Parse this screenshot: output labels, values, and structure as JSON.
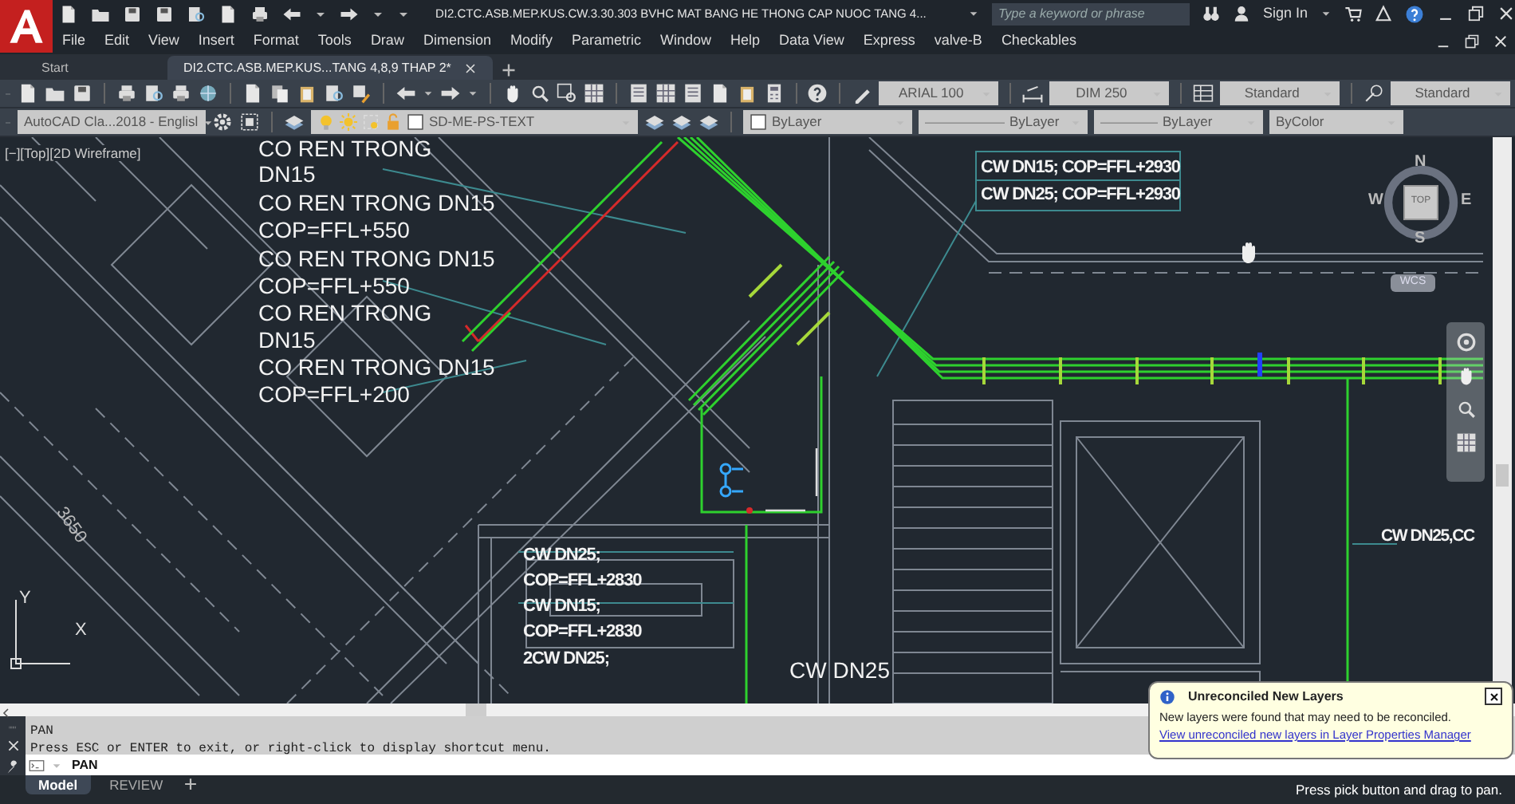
{
  "app_title": "DI2.CTC.ASB.MEP.KUS.CW.3.30.303 BVHC MAT BANG HE THONG CAP NUOC TANG 4...",
  "search": {
    "placeholder": "Type a keyword or phrase"
  },
  "sign_in": "Sign In",
  "menu": [
    "File",
    "Edit",
    "View",
    "Insert",
    "Format",
    "Tools",
    "Draw",
    "Dimension",
    "Modify",
    "Parametric",
    "Window",
    "Help",
    "Data View",
    "Express",
    "valve-B",
    "Checkables"
  ],
  "doc_tabs": [
    {
      "label": "Start",
      "selected": false
    },
    {
      "label": "DI2.CTC.ASB.MEP.KUS...TANG 4,8,9 THAP 2*",
      "selected": true
    }
  ],
  "style_dropdowns": [
    {
      "kind": "text",
      "value": "ARIAL 100"
    },
    {
      "kind": "dimension",
      "value": "DIM 250"
    },
    {
      "kind": "table",
      "value": "Standard"
    },
    {
      "kind": "multileader",
      "value": "Standard"
    }
  ],
  "workspace": "AutoCAD Cla...2018 - Englisl",
  "layer": "SD-ME-PS-TEXT",
  "property_dropdowns": [
    {
      "kind": "color",
      "value": "ByLayer"
    },
    {
      "kind": "linetype",
      "value": "ByLayer"
    },
    {
      "kind": "lineweight",
      "value": "ByLayer"
    },
    {
      "kind": "plotstyle",
      "value": "ByColor"
    }
  ],
  "viewport_label": "[−][Top][2D Wireframe]",
  "annotations": [
    "CO REN TRONG",
    "DN15",
    "CO REN TRONG DN15",
    "COP=FFL+550",
    "CO REN TRONG DN15",
    "COP=FFL+550",
    "CO REN TRONG",
    "DN15",
    "CO REN TRONG DN15",
    "COP=FFL+200",
    "CW DN15; COP=FFL+2930",
    "CW DN25; COP=FFL+2930",
    "CW DN25;",
    "COP=FFL+2830",
    "CW DN15;",
    "COP=FFL+2830",
    "2CW DN25;",
    "CW DN25",
    "CW DN25,CC",
    "3650"
  ],
  "viewcube": {
    "face": "TOP",
    "north": "N",
    "south": "S",
    "east": "E",
    "west": "W",
    "ucs": "WCS"
  },
  "ucs_axes": {
    "x": "X",
    "y": "Y"
  },
  "command_history": [
    "PAN",
    "Press ESC or ENTER to exit, or right-click to display shortcut menu."
  ],
  "command_line": "PAN",
  "layout_tabs": [
    {
      "label": "Model",
      "selected": true
    },
    {
      "label": "REVIEW",
      "selected": false
    }
  ],
  "notification": {
    "title": "Unreconciled New Layers",
    "message": "New layers were found that may need to be reconciled.",
    "link": "View unreconciled new layers in Layer Properties Manager"
  },
  "status_prompt": "Press pick button and drag to pan."
}
